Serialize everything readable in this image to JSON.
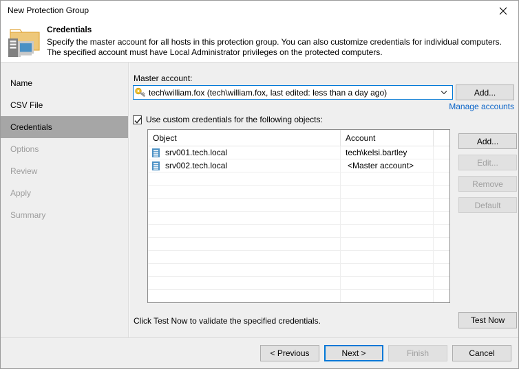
{
  "window": {
    "title": "New Protection Group",
    "close_icon": "close-icon"
  },
  "header": {
    "icon": "protection-group-folder-server-icon",
    "title": "Credentials",
    "description": "Specify the master account for all hosts in this protection group. You can also customize credentials for individual computers. The specified account must have Local Administrator privileges on the protected computers."
  },
  "sidebar": {
    "items": [
      {
        "label": "Name",
        "state": "visited"
      },
      {
        "label": "CSV File",
        "state": "visited"
      },
      {
        "label": "Credentials",
        "state": "active"
      },
      {
        "label": "Options",
        "state": "pending"
      },
      {
        "label": "Review",
        "state": "pending"
      },
      {
        "label": "Apply",
        "state": "pending"
      },
      {
        "label": "Summary",
        "state": "pending"
      }
    ]
  },
  "main": {
    "master_account_label": "Master account:",
    "master_account": {
      "icon": "key-icon",
      "value": "tech\\william.fox (tech\\william.fox, last edited: less than a day ago)",
      "dropdown_icon": "chevron-down-icon"
    },
    "add_master_label": "Add...",
    "manage_accounts_link": "Manage accounts",
    "custom_credentials": {
      "checked": true,
      "label": "Use custom credentials for the following objects:"
    },
    "grid": {
      "columns": [
        "Object",
        "Account",
        ""
      ],
      "rows": [
        {
          "icon": "server-icon",
          "object": "srv001.tech.local",
          "account": "tech\\kelsi.bartley"
        },
        {
          "icon": "server-icon",
          "object": "srv002.tech.local",
          "account": "<Master account>"
        }
      ],
      "empty_row_count": 12
    },
    "side_buttons": [
      {
        "label": "Add...",
        "enabled": true
      },
      {
        "label": "Edit...",
        "enabled": false
      },
      {
        "label": "Remove",
        "enabled": false
      },
      {
        "label": "Default",
        "enabled": false
      }
    ],
    "test_note": "Click Test Now to validate the specified credentials.",
    "test_button_label": "Test Now"
  },
  "footer": {
    "buttons": [
      {
        "label": "< Previous",
        "enabled": true,
        "focused": false
      },
      {
        "label": "Next >",
        "enabled": true,
        "focused": true
      },
      {
        "label": "Finish",
        "enabled": false,
        "focused": false
      },
      {
        "label": "Cancel",
        "enabled": true,
        "focused": false
      }
    ]
  },
  "colors": {
    "accent": "#0078d7",
    "link": "#0a64c8",
    "panel": "#efefef",
    "active_nav": "#a6a6a6",
    "folder": "#eec87a",
    "server_blue": "#4a90c4"
  }
}
